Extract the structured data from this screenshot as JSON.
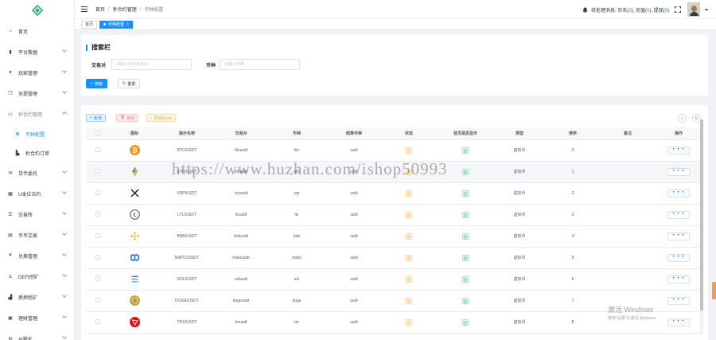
{
  "sidebar": {
    "items": [
      {
        "label": "首页",
        "icon": "home-icon",
        "glyph": "⌂",
        "arrow": false
      },
      {
        "label": "平台数据",
        "icon": "chart-icon",
        "glyph": "▮",
        "arrow": true
      },
      {
        "label": "玩家管理",
        "icon": "user-icon",
        "glyph": "●",
        "arrow": true
      },
      {
        "label": "充提管理",
        "icon": "copy-icon",
        "glyph": "❐",
        "arrow": true
      },
      {
        "label": "秒合约管理",
        "icon": "monitor-icon",
        "glyph": "▭",
        "arrow": true,
        "expanded": true,
        "muted": true
      },
      {
        "label": "币种配置",
        "icon": "gear-icon",
        "glyph": "✿",
        "arrow": false,
        "sub": true,
        "active": true
      },
      {
        "label": "秒合约订单",
        "icon": "doc-icon",
        "glyph": "▙",
        "arrow": false,
        "sub": true
      },
      {
        "label": "货币委托",
        "icon": "mail-icon",
        "glyph": "✉",
        "arrow": true
      },
      {
        "label": "U本位合约",
        "icon": "grid-icon",
        "glyph": "▦",
        "arrow": true
      },
      {
        "label": "交易所",
        "icon": "list-icon",
        "glyph": "☰",
        "arrow": true
      },
      {
        "label": "币币交易",
        "icon": "table-icon",
        "glyph": "▤",
        "arrow": true
      },
      {
        "label": "兑换管理",
        "icon": "yen-icon",
        "glyph": "¥",
        "arrow": true
      },
      {
        "label": "DEFI挖矿",
        "icon": "person-icon",
        "glyph": "♙",
        "arrow": true
      },
      {
        "label": "质押挖矿",
        "icon": "bar-icon",
        "glyph": "▟",
        "arrow": true
      },
      {
        "label": "理财管理",
        "icon": "wallet-icon",
        "glyph": "▣",
        "arrow": true
      },
      {
        "label": "AI量化",
        "icon": "robot-icon",
        "glyph": "◍",
        "arrow": true
      }
    ]
  },
  "header": {
    "breadcrumb": [
      "首页",
      "秒合约管理",
      "币种配置"
    ],
    "notice": {
      "prefix": "待处理消息: ",
      "real_label": "实名(",
      "real_count": "0",
      "deposit_label": "), 充值(",
      "deposit_count": "0",
      "withdraw_label": "), 提现(",
      "withdraw_count": "0",
      "suffix": ")"
    }
  },
  "tabs": [
    {
      "label": "首页",
      "active": false
    },
    {
      "label": "币种配置",
      "active": true
    }
  ],
  "search": {
    "title": "搜索栏",
    "pair_label": "交易对",
    "pair_placeholder": "请输入合约交易对",
    "coin_label": "币种",
    "coin_placeholder": "请输入币种",
    "search_button": "搜索",
    "reset_button": "重置"
  },
  "toolbar": {
    "add": "新增",
    "delete": "删除",
    "export": "导出Excel"
  },
  "table": {
    "headers": [
      "",
      "图标",
      "展示名称",
      "交易对",
      "币种",
      "结算币种",
      "状态",
      "首页是否显示",
      "类型",
      "排序",
      "备注",
      "操作"
    ],
    "rows": [
      {
        "icon": "btc",
        "name": "BTC/USDT",
        "pair": "btcusdt",
        "coin": "btc",
        "settle": "usdt",
        "status": "开",
        "show": "是",
        "type": "虚拟币",
        "sort": "0",
        "note": ""
      },
      {
        "icon": "eth",
        "name": "ETH/USDT",
        "pair": "ethusdt",
        "coin": "eth",
        "settle": "usdt",
        "status": "开",
        "show": "是",
        "type": "虚拟币",
        "sort": "1",
        "note": ""
      },
      {
        "icon": "xrp",
        "name": "XRP/USDT",
        "pair": "xrpusdt",
        "coin": "xrp",
        "settle": "usdt",
        "status": "开",
        "show": "是",
        "type": "虚拟币",
        "sort": "2",
        "note": ""
      },
      {
        "icon": "ltc",
        "name": "LTC/USDT",
        "pair": "ltcusdt",
        "coin": "ltc",
        "settle": "usdt",
        "status": "开",
        "show": "是",
        "type": "虚拟币",
        "sort": "3",
        "note": ""
      },
      {
        "icon": "bnb",
        "name": "BNB/USDT",
        "pair": "bnbusdt",
        "coin": "bnb",
        "settle": "usdt",
        "status": "开",
        "show": "是",
        "type": "虚拟币",
        "sort": "4",
        "note": ""
      },
      {
        "icon": "matic",
        "name": "MATIC/USDT",
        "pair": "maticusdt",
        "coin": "matic",
        "settle": "usdt",
        "status": "开",
        "show": "是",
        "type": "虚拟币",
        "sort": "5",
        "note": ""
      },
      {
        "icon": "sol",
        "name": "SOL/USDT",
        "pair": "solusdt",
        "coin": "sol",
        "settle": "usdt",
        "status": "开",
        "show": "是",
        "type": "虚拟币",
        "sort": "6",
        "note": ""
      },
      {
        "icon": "doge",
        "name": "DOGE/USDT",
        "pair": "dogeusdt",
        "coin": "doge",
        "settle": "usdt",
        "status": "开",
        "show": "是",
        "type": "虚拟币",
        "sort": "7",
        "note": ""
      },
      {
        "icon": "trx",
        "name": "TRX/USDT",
        "pair": "trxusdt",
        "coin": "trx",
        "settle": "usdt",
        "status": "开",
        "show": "是",
        "type": "虚拟币",
        "sort": "8",
        "note": ""
      }
    ],
    "more": "• • •"
  },
  "watermark": "https://www.huzhan.com/ishop50993",
  "windows": {
    "line1": "激活 Windows",
    "line2": "转到\"设置\"以激活 Windows"
  },
  "colors": {
    "primary": "#1890ff",
    "btc": "#f7931a",
    "bnb": "#f3ba2f",
    "matic": "#2b6def",
    "doge": "#c2a633",
    "trx": "#e50915",
    "open_tag": "#e6a23c",
    "yes_tag": "#19be6b"
  }
}
